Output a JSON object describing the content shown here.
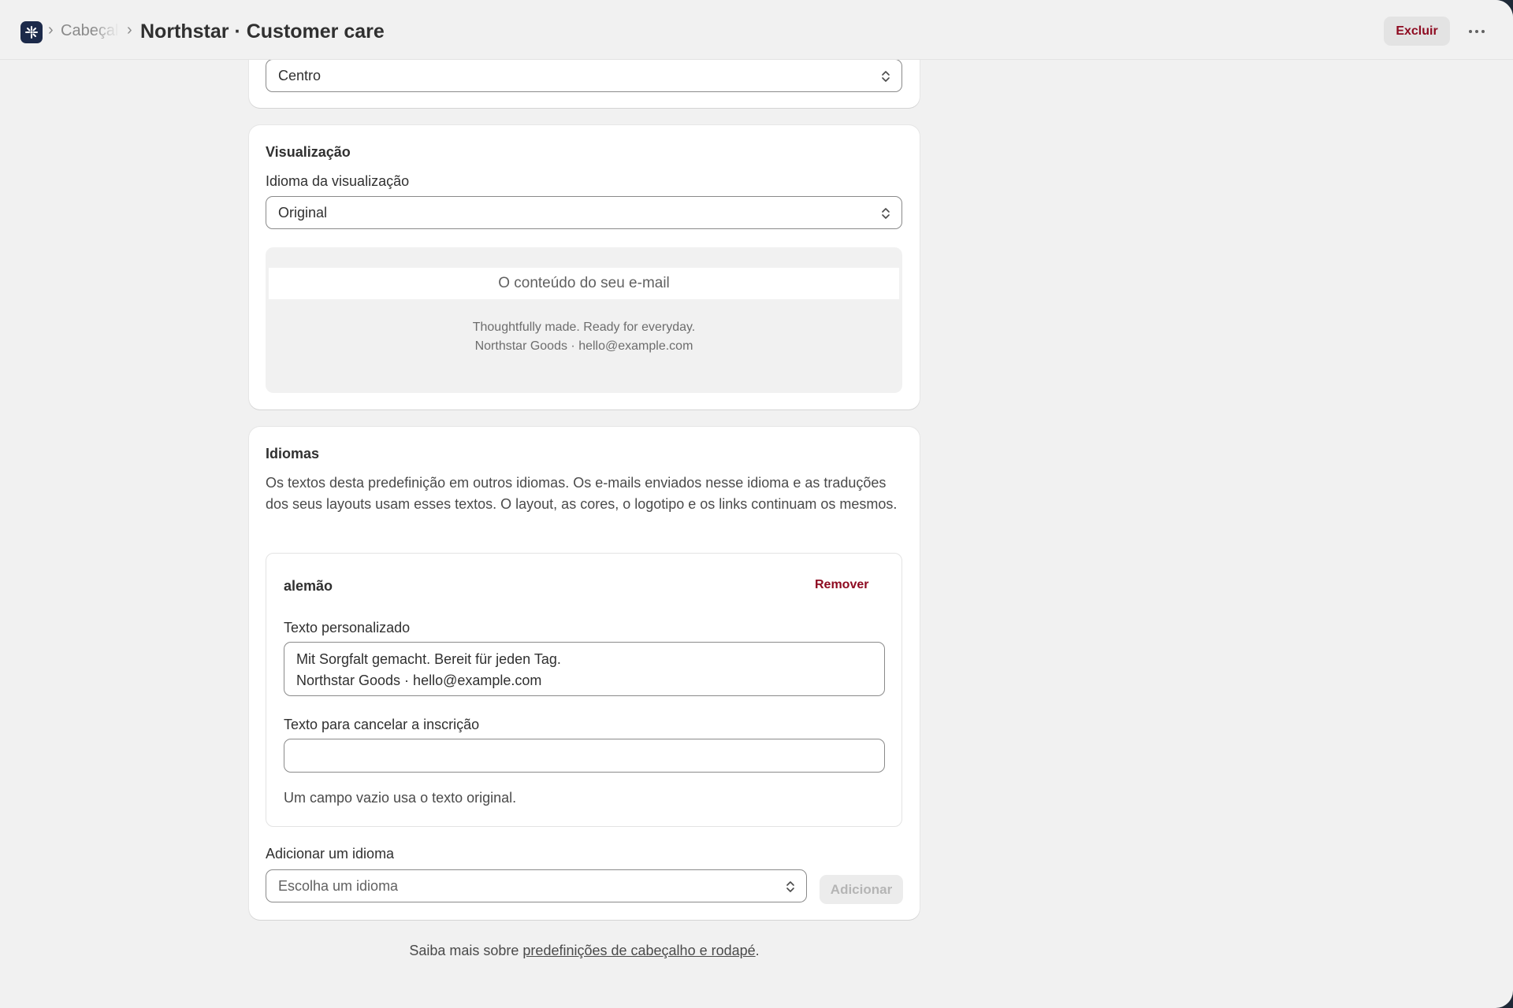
{
  "header": {
    "breadcrumb_parent": "Cabeçalho",
    "title": "Northstar · Customer care",
    "delete_label": "Excluir",
    "more_icon": "more-horizontal-icon",
    "app_icon": "app-logo-icon"
  },
  "alignment_card": {
    "select_value": "Centro"
  },
  "preview_card": {
    "title": "Visualização",
    "language_label": "Idioma da visualização",
    "language_value": "Original",
    "email_content_placeholder": "O conteúdo do seu e-mail",
    "footer_line1": "Thoughtfully made. Ready for everyday.",
    "footer_line2": "Northstar Goods · hello@example.com"
  },
  "languages_card": {
    "title": "Idiomas",
    "description": "Os textos desta predefinição em outros idiomas. Os e-mails enviados nesse idioma e as traduções dos seus layouts usam esses textos. O layout, as cores, o logotipo e os links continuam os mesmos.",
    "entries": [
      {
        "name": "alemão",
        "remove_label": "Remover",
        "custom_text_label": "Texto personalizado",
        "custom_text_value": "Mit Sorgfalt gemacht. Bereit für jeden Tag.\nNorthstar Goods · hello@example.com",
        "unsubscribe_label": "Texto para cancelar a inscrição",
        "unsubscribe_value": "",
        "help_text": "Um campo vazio usa o texto original."
      }
    ],
    "add_language_label": "Adicionar um idioma",
    "add_language_placeholder": "Escolha um idioma",
    "add_button_label": "Adicionar"
  },
  "footer": {
    "prefix": "Saiba mais sobre ",
    "link_text": "predefinições de cabeçalho e rodapé",
    "suffix": "."
  }
}
